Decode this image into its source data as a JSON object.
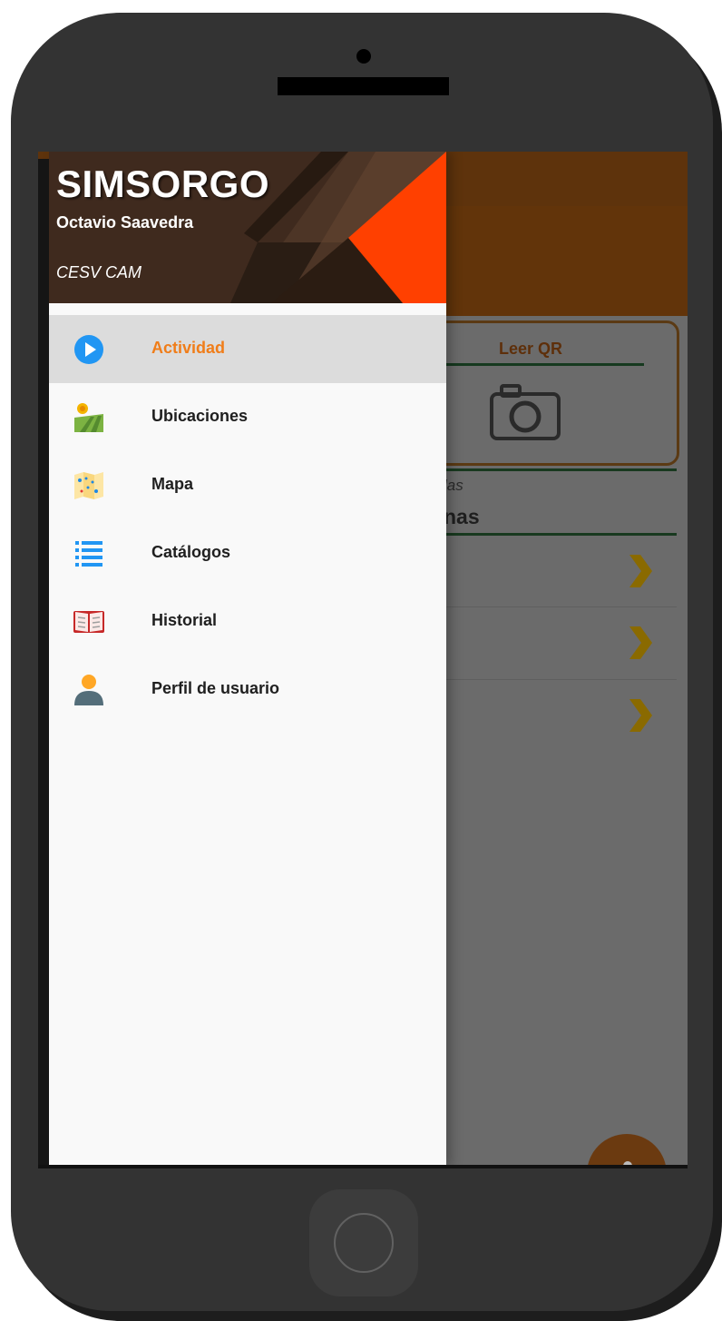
{
  "drawer": {
    "app_title": "SIMSORGO",
    "user_name": "Octavio Saavedra",
    "organization": "CESV CAM",
    "items": [
      {
        "label": "Actividad",
        "icon": "play-circle-icon",
        "active": true
      },
      {
        "label": "Ubicaciones",
        "icon": "field-sun-icon",
        "active": false
      },
      {
        "label": "Mapa",
        "icon": "map-icon",
        "active": false
      },
      {
        "label": "Catálogos",
        "icon": "list-icon",
        "active": false
      },
      {
        "label": "Historial",
        "icon": "open-book-icon",
        "active": false
      },
      {
        "label": "Perfil de usuario",
        "icon": "user-icon",
        "active": false
      }
    ]
  },
  "background": {
    "qr_label": "Leer QR",
    "section_subtitle_fragment": "las",
    "section_title_fragment": "nas"
  },
  "colors": {
    "accent_orange": "#f07d19",
    "header_brown": "#3f2a1e",
    "header_highlight": "#ff4000",
    "toolbar_brown": "#5e330c",
    "chevron_gold": "#8a6a00"
  }
}
